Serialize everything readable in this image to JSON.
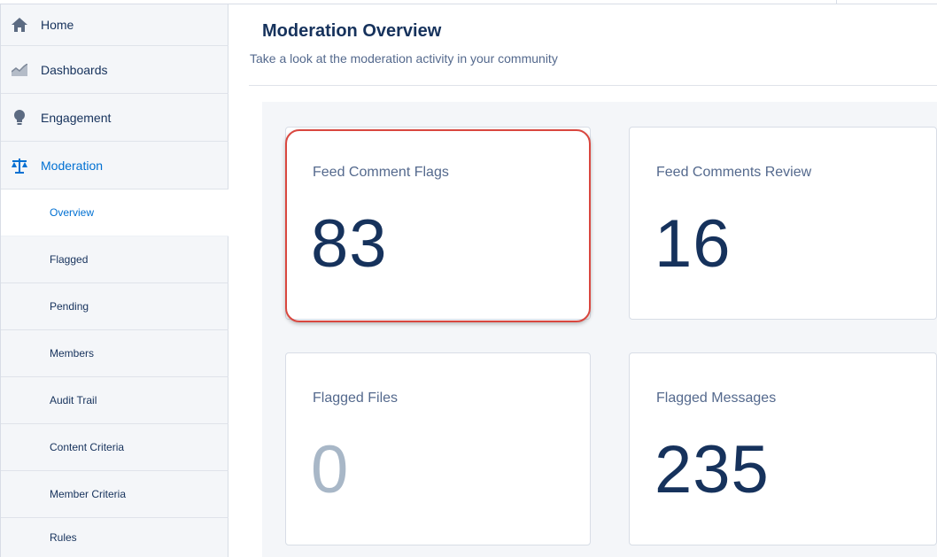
{
  "sidebar": {
    "items": [
      {
        "label": "Home",
        "icon": "home-icon"
      },
      {
        "label": "Dashboards",
        "icon": "chart-icon"
      },
      {
        "label": "Engagement",
        "icon": "lightbulb-icon"
      },
      {
        "label": "Moderation",
        "icon": "scales-icon"
      }
    ],
    "subitems": [
      {
        "label": "Overview"
      },
      {
        "label": "Flagged"
      },
      {
        "label": "Pending"
      },
      {
        "label": "Members"
      },
      {
        "label": "Audit Trail"
      },
      {
        "label": "Content Criteria"
      },
      {
        "label": "Member Criteria"
      },
      {
        "label": "Rules"
      }
    ],
    "selected": "Overview"
  },
  "header": {
    "title": "Moderation Overview",
    "subtitle": "Take a look at the moderation activity in your community"
  },
  "cards": [
    {
      "label": "Feed Comment Flags",
      "value": "83"
    },
    {
      "label": "Feed Comments Review",
      "value": "16"
    },
    {
      "label": "Flagged Files",
      "value": "0"
    },
    {
      "label": "Flagged Messages",
      "value": "235"
    }
  ],
  "colors": {
    "accent": "#0070d2",
    "text": "#16325c",
    "muted": "#54698d",
    "highlight": "#d9473f",
    "panel": "#f4f6f9"
  }
}
